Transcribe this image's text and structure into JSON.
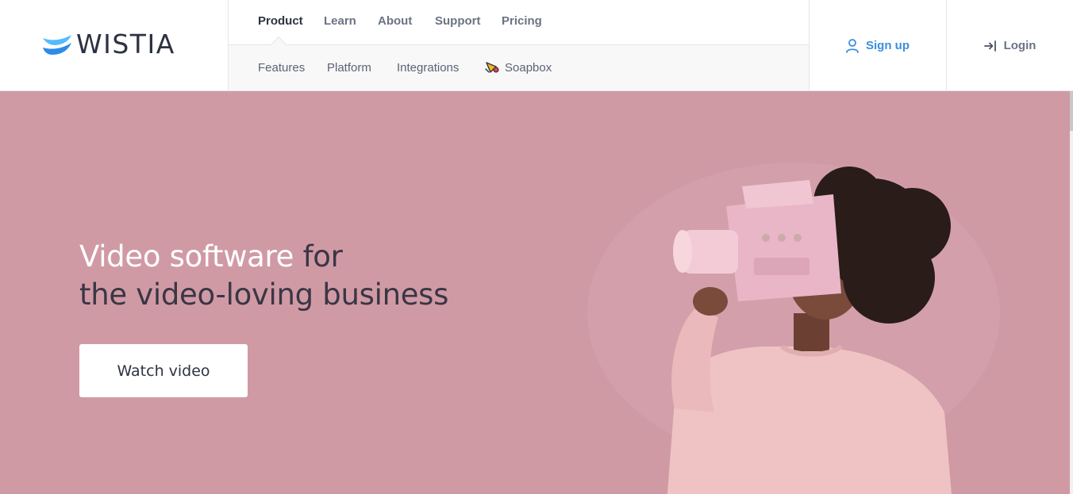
{
  "brand": {
    "name": "WISTIA",
    "logo_colors": [
      "#54bbff",
      "#2c8be8",
      "#1b6fd1"
    ]
  },
  "nav": {
    "primary": [
      {
        "label": "Product",
        "active": true
      },
      {
        "label": "Learn",
        "active": false
      },
      {
        "label": "About",
        "active": false
      },
      {
        "label": "Support",
        "active": false
      },
      {
        "label": "Pricing",
        "active": false
      }
    ],
    "secondary": [
      {
        "label": "Features"
      },
      {
        "label": "Platform"
      },
      {
        "label": "Integrations"
      },
      {
        "label": "Soapbox",
        "icon": "soapbox-megaphone-icon"
      }
    ]
  },
  "account": {
    "signup_label": "Sign up",
    "signup_icon": "user-icon",
    "login_label": "Login",
    "login_icon": "login-arrow-icon"
  },
  "hero": {
    "title_highlight": "Video software",
    "title_rest_line1": " for",
    "title_line2": "the video-loving business",
    "cta_label": "Watch video",
    "background_color": "#d09aa5"
  },
  "colors": {
    "accent": "#3a8fde",
    "text_dark": "#2e3342",
    "nav_muted": "#6b7384"
  }
}
